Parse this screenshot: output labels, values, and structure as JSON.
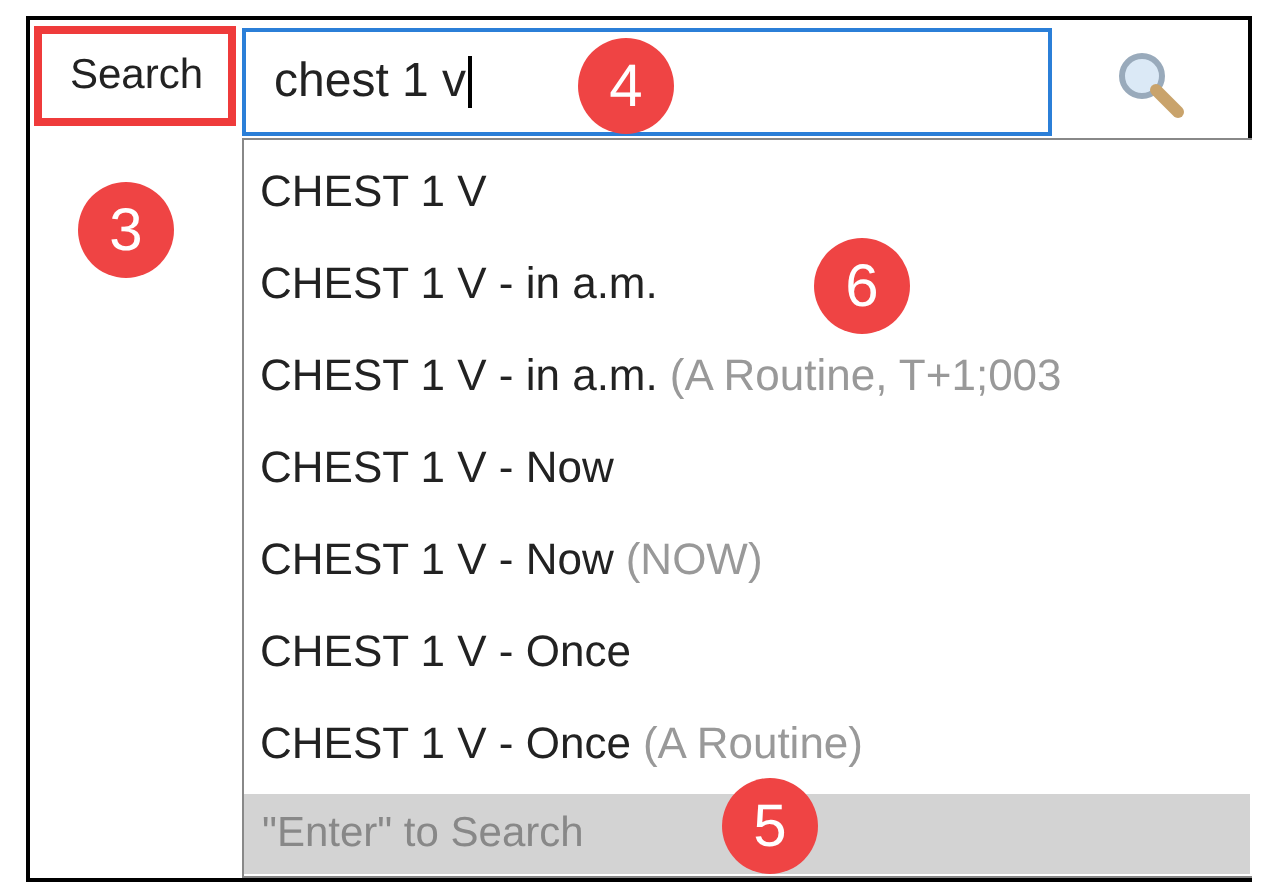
{
  "search_label": {
    "text": "Search",
    "highlighted": true
  },
  "search_field": {
    "value": "chest 1 v",
    "focused": true
  },
  "suggestions": [
    {
      "text": "CHEST 1 V"
    },
    {
      "text": "CHEST 1 V - in a.m."
    },
    {
      "text": "CHEST 1 V - in a.m.",
      "detail": "(A Routine, T+1;003"
    },
    {
      "text": "CHEST 1 V - Now"
    },
    {
      "text": "CHEST 1 V - Now",
      "detail": "(NOW)"
    },
    {
      "text": "CHEST 1 V - Once"
    },
    {
      "text": "CHEST 1 V - Once",
      "detail": "(A Routine)"
    }
  ],
  "footer": "\"Enter\" to Search",
  "callouts": [
    {
      "label": "3"
    },
    {
      "label": "4"
    },
    {
      "label": "6"
    },
    {
      "label": "5"
    }
  ]
}
